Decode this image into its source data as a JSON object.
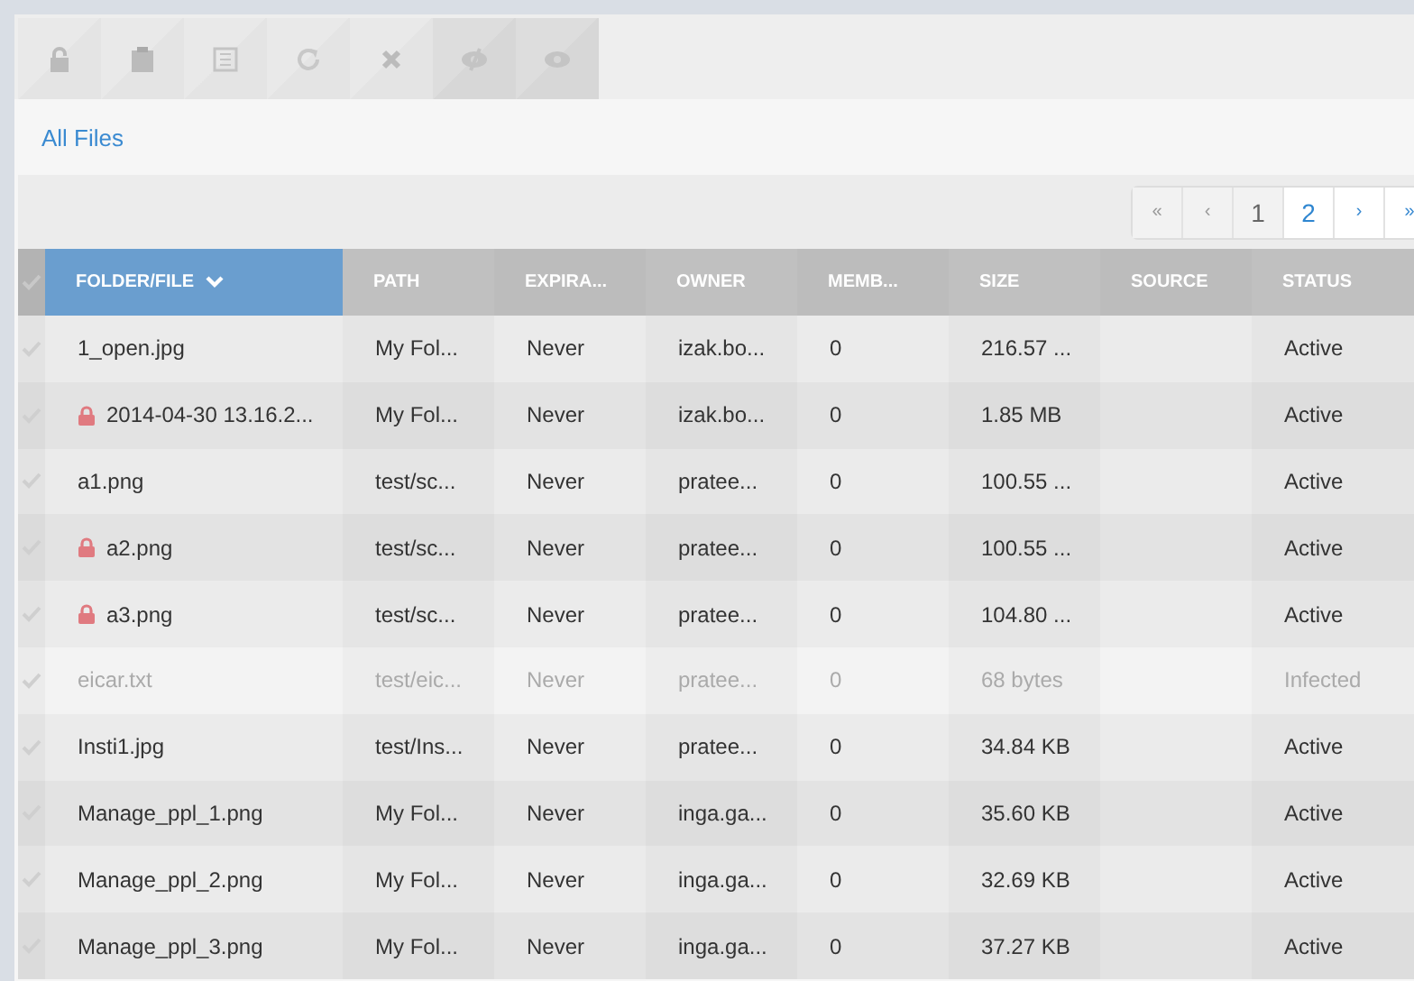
{
  "toolbar": [
    {
      "kind": "unlock",
      "disabled": true
    },
    {
      "kind": "clipboard",
      "disabled": true
    },
    {
      "kind": "list",
      "disabled": true
    },
    {
      "kind": "refresh",
      "disabled": true
    },
    {
      "kind": "close",
      "disabled": true
    },
    {
      "kind": "eye-slash",
      "disabled": false
    },
    {
      "kind": "eye",
      "disabled": false
    }
  ],
  "breadcrumb": "All Files",
  "pagination": [
    {
      "label": "«",
      "selected": false
    },
    {
      "label": "‹",
      "selected": false
    },
    {
      "label": "1",
      "selected": true
    },
    {
      "label": "2",
      "selected": false
    },
    {
      "label": "›",
      "selected": false
    },
    {
      "label": "»",
      "selected": false
    }
  ],
  "table": {
    "select_all": {
      "checked": false
    },
    "columns": [
      {
        "label": "FOLDER/FILE",
        "sorted": true
      },
      {
        "label": "PATH",
        "sorted": false
      },
      {
        "label": "EXPIRA...",
        "sorted": false
      },
      {
        "label": "OWNER",
        "sorted": false
      },
      {
        "label": "MEMB...",
        "sorted": false
      },
      {
        "label": "SIZE",
        "sorted": false
      },
      {
        "label": "SOURCE",
        "sorted": false
      },
      {
        "label": "STATUS",
        "sorted": false
      }
    ],
    "rows": [
      {
        "locked": false,
        "disabled": false,
        "cells": [
          "1_open.jpg",
          "My Fol...",
          "Never",
          "izak.bo...",
          "0",
          "216.57 ...",
          "",
          "Active"
        ]
      },
      {
        "locked": true,
        "disabled": false,
        "cells": [
          "2014-04-30 13.16.2...",
          "My Fol...",
          "Never",
          "izak.bo...",
          "0",
          "1.85 MB",
          "",
          "Active"
        ]
      },
      {
        "locked": false,
        "disabled": false,
        "cells": [
          "a1.png",
          "test/sc...",
          "Never",
          "pratee...",
          "0",
          "100.55 ...",
          "",
          "Active"
        ]
      },
      {
        "locked": true,
        "disabled": false,
        "cells": [
          "a2.png",
          "test/sc...",
          "Never",
          "pratee...",
          "0",
          "100.55 ...",
          "",
          "Active"
        ]
      },
      {
        "locked": true,
        "disabled": false,
        "cells": [
          "a3.png",
          "test/sc...",
          "Never",
          "pratee...",
          "0",
          "104.80 ...",
          "",
          "Active"
        ]
      },
      {
        "locked": false,
        "disabled": true,
        "cells": [
          "eicar.txt",
          "test/eic...",
          "Never",
          "pratee...",
          "0",
          "68 bytes",
          "",
          "Infected"
        ]
      },
      {
        "locked": false,
        "disabled": false,
        "cells": [
          "Insti1.jpg",
          "test/Ins...",
          "Never",
          "pratee...",
          "0",
          "34.84 KB",
          "",
          "Active"
        ]
      },
      {
        "locked": false,
        "disabled": false,
        "cells": [
          "Manage_ppl_1.png",
          "My Fol...",
          "Never",
          "inga.ga...",
          "0",
          "35.60 KB",
          "",
          "Active"
        ]
      },
      {
        "locked": false,
        "disabled": false,
        "cells": [
          "Manage_ppl_2.png",
          "My Fol...",
          "Never",
          "inga.ga...",
          "0",
          "32.69 KB",
          "",
          "Active"
        ]
      },
      {
        "locked": false,
        "disabled": false,
        "cells": [
          "Manage_ppl_3.png",
          "My Fol...",
          "Never",
          "inga.ga...",
          "0",
          "37.27 KB",
          "",
          "Active"
        ]
      }
    ]
  }
}
